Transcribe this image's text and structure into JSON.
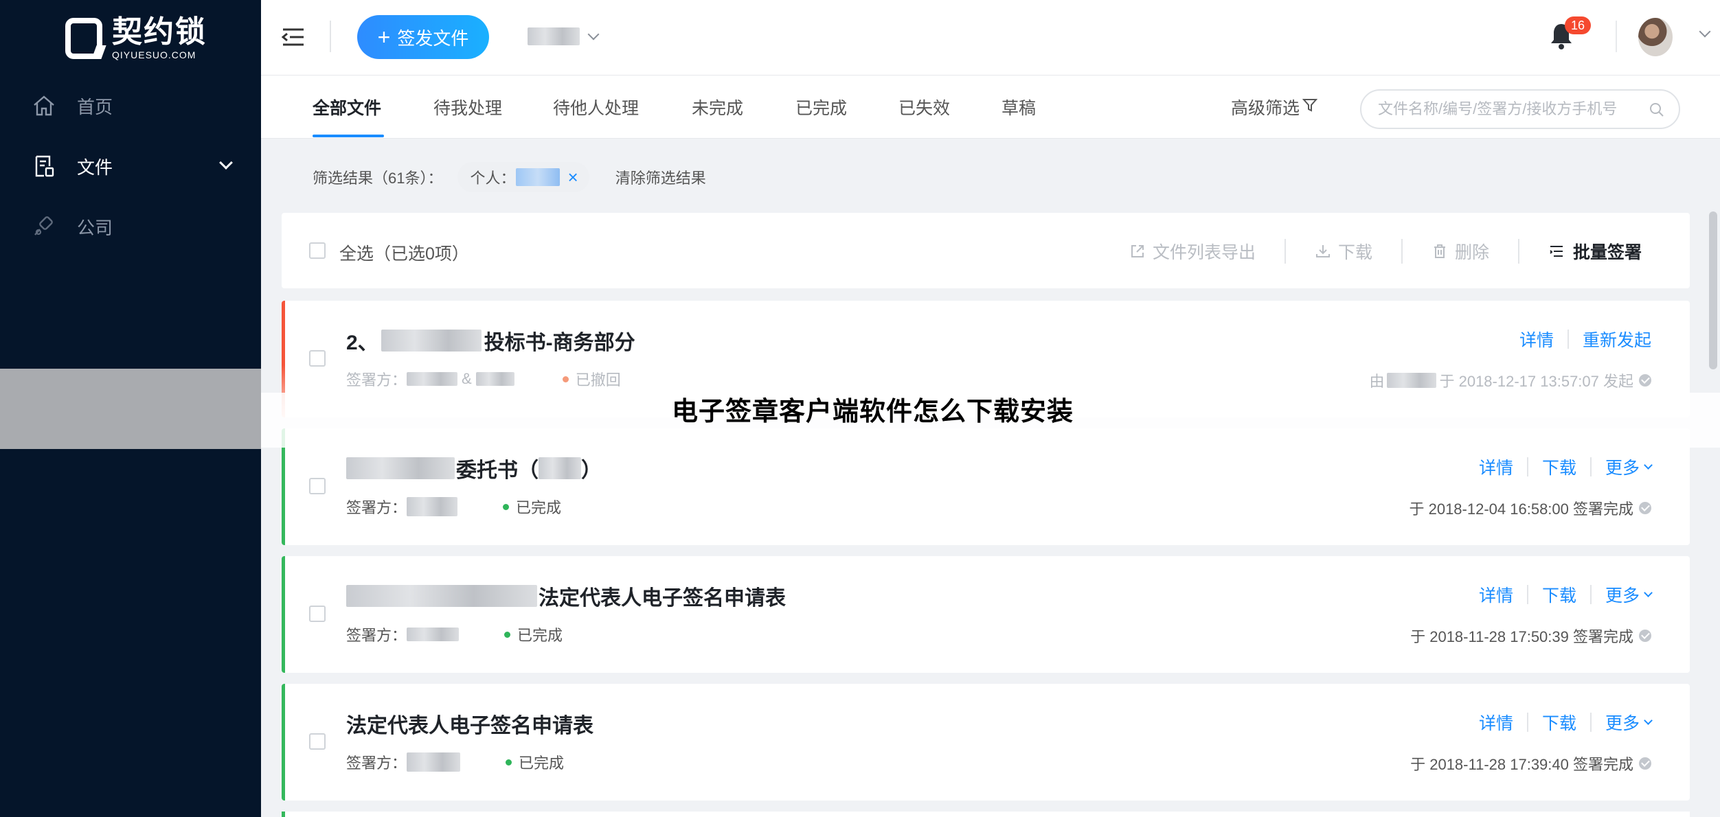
{
  "brand": {
    "name_cn": "契约锁",
    "name_en": "QIYUESUO.COM"
  },
  "sidebar": {
    "items": [
      {
        "label": "首页",
        "icon": "home-icon",
        "active": false
      },
      {
        "label": "文件",
        "icon": "document-icon",
        "active": true
      },
      {
        "label": "公司",
        "icon": "link-icon",
        "active": false
      }
    ]
  },
  "header": {
    "issue_button": "签发文件",
    "notification_count": "16"
  },
  "tabs": [
    {
      "label": "全部文件",
      "active": true
    },
    {
      "label": "待我处理",
      "active": false
    },
    {
      "label": "待他人处理",
      "active": false
    },
    {
      "label": "未完成",
      "active": false
    },
    {
      "label": "已完成",
      "active": false
    },
    {
      "label": "已失效",
      "active": false
    },
    {
      "label": "草稿",
      "active": false
    }
  ],
  "advanced_filter": "高级筛选",
  "search": {
    "placeholder": "文件名称/编号/签署方/接收方手机号",
    "value": ""
  },
  "filter": {
    "result_label": "筛选结果（61条）：",
    "chip_label": "个人：",
    "clear_label": "清除筛选结果"
  },
  "bulk": {
    "select_all": "全选（已选0项）",
    "export": "文件列表导出",
    "download": "下载",
    "delete": "删除",
    "batch_sign": "批量签署"
  },
  "overlay_title": "电子签章客户端软件怎么下载安装",
  "documents": [
    {
      "title_prefix": "2、",
      "title": "投标书-商务部分",
      "signers_label": "签署方：",
      "signers_sep": "&",
      "status": "已撤回",
      "status_color": "#f59a7a",
      "stripe_color": "#f5553a",
      "actions": [
        "详情",
        "重新发起"
      ],
      "time_prefix": "由",
      "time": "于 2018-12-17 13:57:07 发起"
    },
    {
      "title_prefix": "",
      "title": "委托书（",
      "title_suffix": "）",
      "signers_label": "签署方：",
      "status": "已完成",
      "status_color": "#2fb55a",
      "stripe_color": "#35b85c",
      "actions": [
        "详情",
        "下载",
        "更多"
      ],
      "time": "于 2018-12-04 16:58:00 签署完成"
    },
    {
      "title_prefix": "",
      "title": "法定代表人电子签名申请表",
      "signers_label": "签署方：",
      "status": "已完成",
      "status_color": "#2fb55a",
      "stripe_color": "#35b85c",
      "actions": [
        "详情",
        "下载",
        "更多"
      ],
      "time": "于 2018-11-28 17:50:39 签署完成"
    },
    {
      "title_prefix": "",
      "title": "法定代表人电子签名申请表",
      "signers_label": "签署方：",
      "status": "已完成",
      "status_color": "#2fb55a",
      "stripe_color": "#35b85c",
      "actions": [
        "详情",
        "下载",
        "更多"
      ],
      "time": "于 2018-11-28 17:39:40 签署完成"
    }
  ]
}
